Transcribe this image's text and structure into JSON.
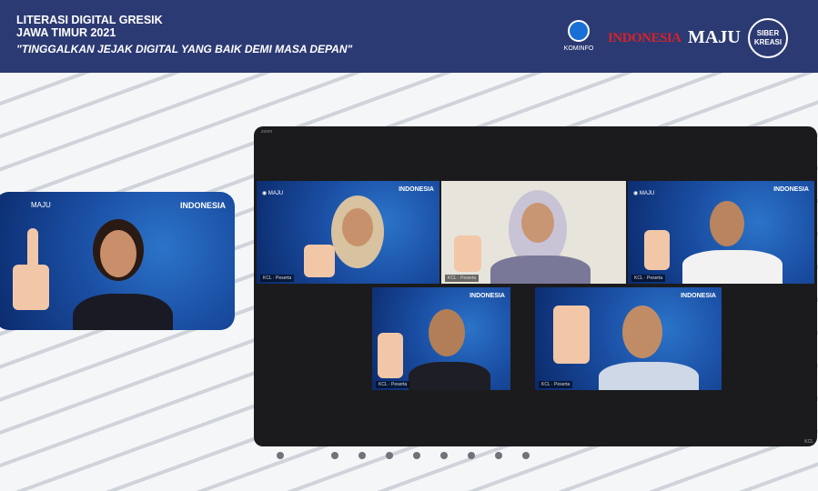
{
  "banner": {
    "title_line1": "LITERASI DIGITAL GRESIK",
    "title_line2": "JAWA TIMUR 2021",
    "tagline": "\"TINGGALKAN JEJAK DIGITAL YANG BAIK DEMI MASA DEPAN\"",
    "logo_kominfo": "KOMINFO",
    "logo_indonesia": "INDONESIA",
    "logo_maju": "MAJU",
    "logo_siber": "SIBER KREASI"
  },
  "speaker": {
    "brand": "INDONESIA",
    "logo_text": "MAJU"
  },
  "zoom": {
    "top_label": "zoom",
    "tiles": [
      {
        "name": "KCL · Peserta",
        "brand": "INDONESIA"
      },
      {
        "name": "KCL · Peserta",
        "brand": ""
      },
      {
        "name": "KCL · Peserta",
        "brand": "INDONESIA"
      },
      {
        "name": "KCL · Peserta",
        "brand": "INDONESIA"
      },
      {
        "name": "KCL · Peserta",
        "brand": "INDONESIA"
      }
    ],
    "corner": "KCL"
  },
  "pager": {
    "count": 10,
    "active": 0
  },
  "colors": {
    "banner": "#2c3a73",
    "brand_red": "#d6232a",
    "blue": "#1a4ea3"
  }
}
